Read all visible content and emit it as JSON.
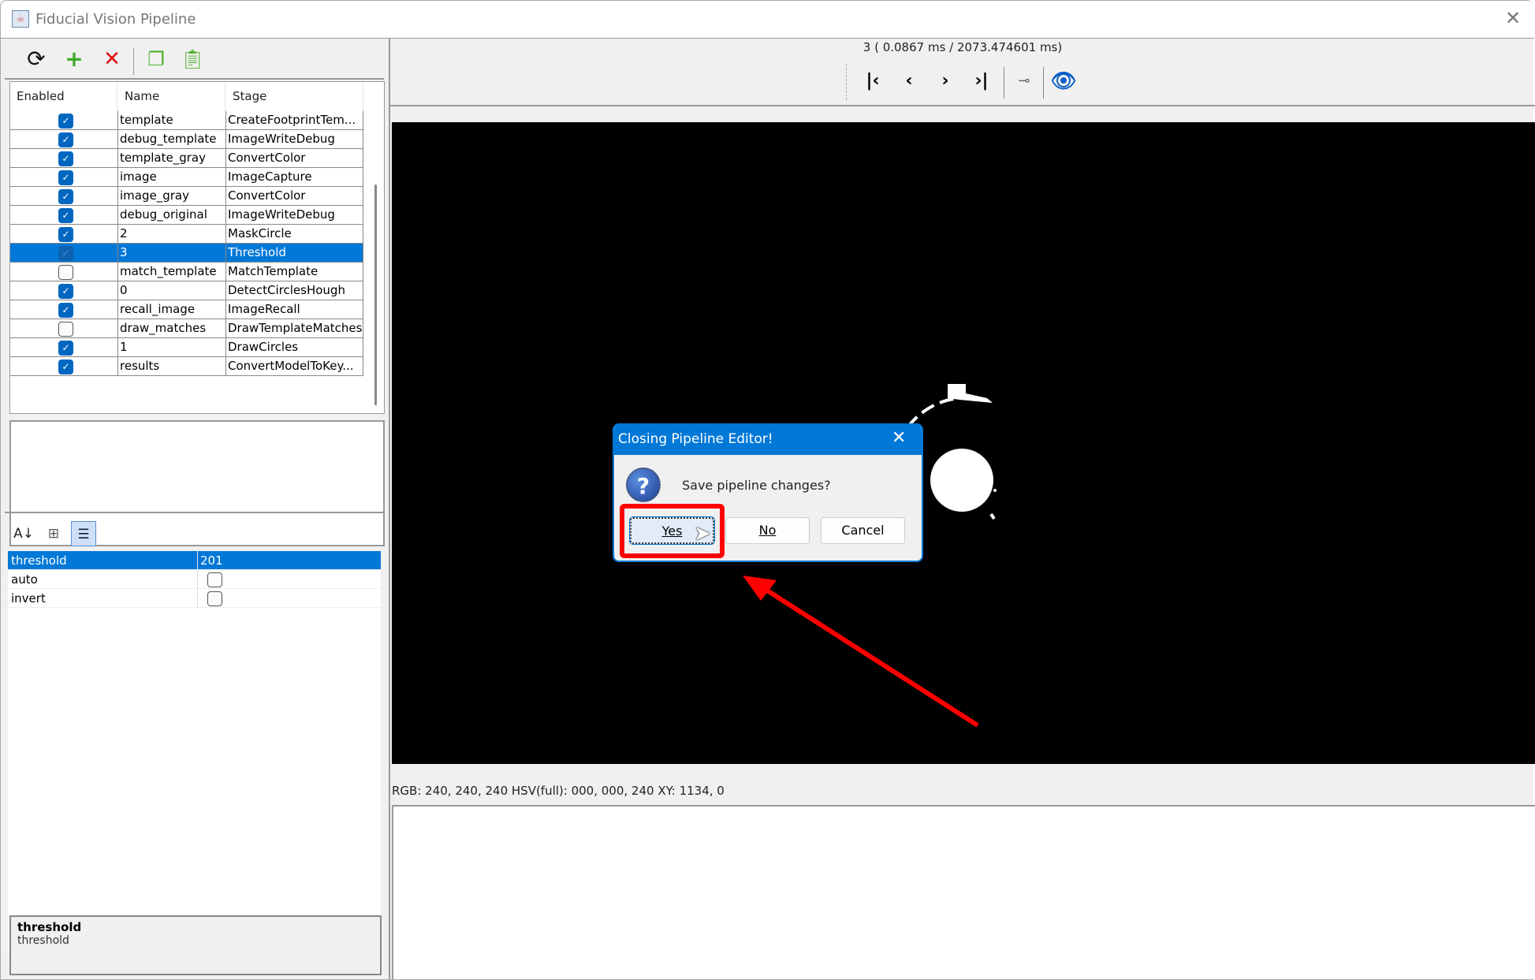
{
  "window": {
    "title": "Fiducial Vision Pipeline",
    "close_icon": "close-icon"
  },
  "toolbar": {
    "icons": [
      "refresh-icon",
      "add-icon",
      "delete-icon",
      "copy-icon",
      "paste-icon"
    ]
  },
  "table": {
    "headers": [
      "Enabled",
      "Name",
      "Stage"
    ],
    "rows": [
      {
        "enabled": true,
        "name": "template",
        "stage": "CreateFootprintTem..."
      },
      {
        "enabled": true,
        "name": "debug_template",
        "stage": "ImageWriteDebug"
      },
      {
        "enabled": true,
        "name": "template_gray",
        "stage": "ConvertColor"
      },
      {
        "enabled": true,
        "name": "image",
        "stage": "ImageCapture"
      },
      {
        "enabled": true,
        "name": "image_gray",
        "stage": "ConvertColor"
      },
      {
        "enabled": true,
        "name": "debug_original",
        "stage": "ImageWriteDebug"
      },
      {
        "enabled": true,
        "name": "2",
        "stage": "MaskCircle"
      },
      {
        "enabled": true,
        "name": "3",
        "stage": "Threshold",
        "selected": true
      },
      {
        "enabled": false,
        "name": "match_template",
        "stage": "MatchTemplate"
      },
      {
        "enabled": true,
        "name": "0",
        "stage": "DetectCirclesHough"
      },
      {
        "enabled": true,
        "name": "recall_image",
        "stage": "ImageRecall"
      },
      {
        "enabled": false,
        "name": "draw_matches",
        "stage": "DrawTemplateMatches"
      },
      {
        "enabled": true,
        "name": "1",
        "stage": "DrawCircles"
      },
      {
        "enabled": true,
        "name": "results",
        "stage": "ConvertModelToKey..."
      }
    ]
  },
  "properties": {
    "rows": [
      {
        "key": "threshold",
        "value": "201"
      },
      {
        "key": "auto",
        "checked": false
      },
      {
        "key": "invert",
        "checked": false
      }
    ],
    "description_title": "threshold",
    "description_text": "threshold"
  },
  "viewer": {
    "timing": "3 ( 0.0867 ms / 2073.474601 ms)",
    "status": "RGB: 240, 240, 240 HSV(full): 000, 000, 240 XY: 1134, 0"
  },
  "dialog": {
    "title": "Closing Pipeline Editor!",
    "message": "Save pipeline changes?",
    "yes": "Yes",
    "no": "No",
    "cancel": "Cancel"
  },
  "colors": {
    "accent": "#0078d7",
    "annotation": "#ff0000"
  }
}
